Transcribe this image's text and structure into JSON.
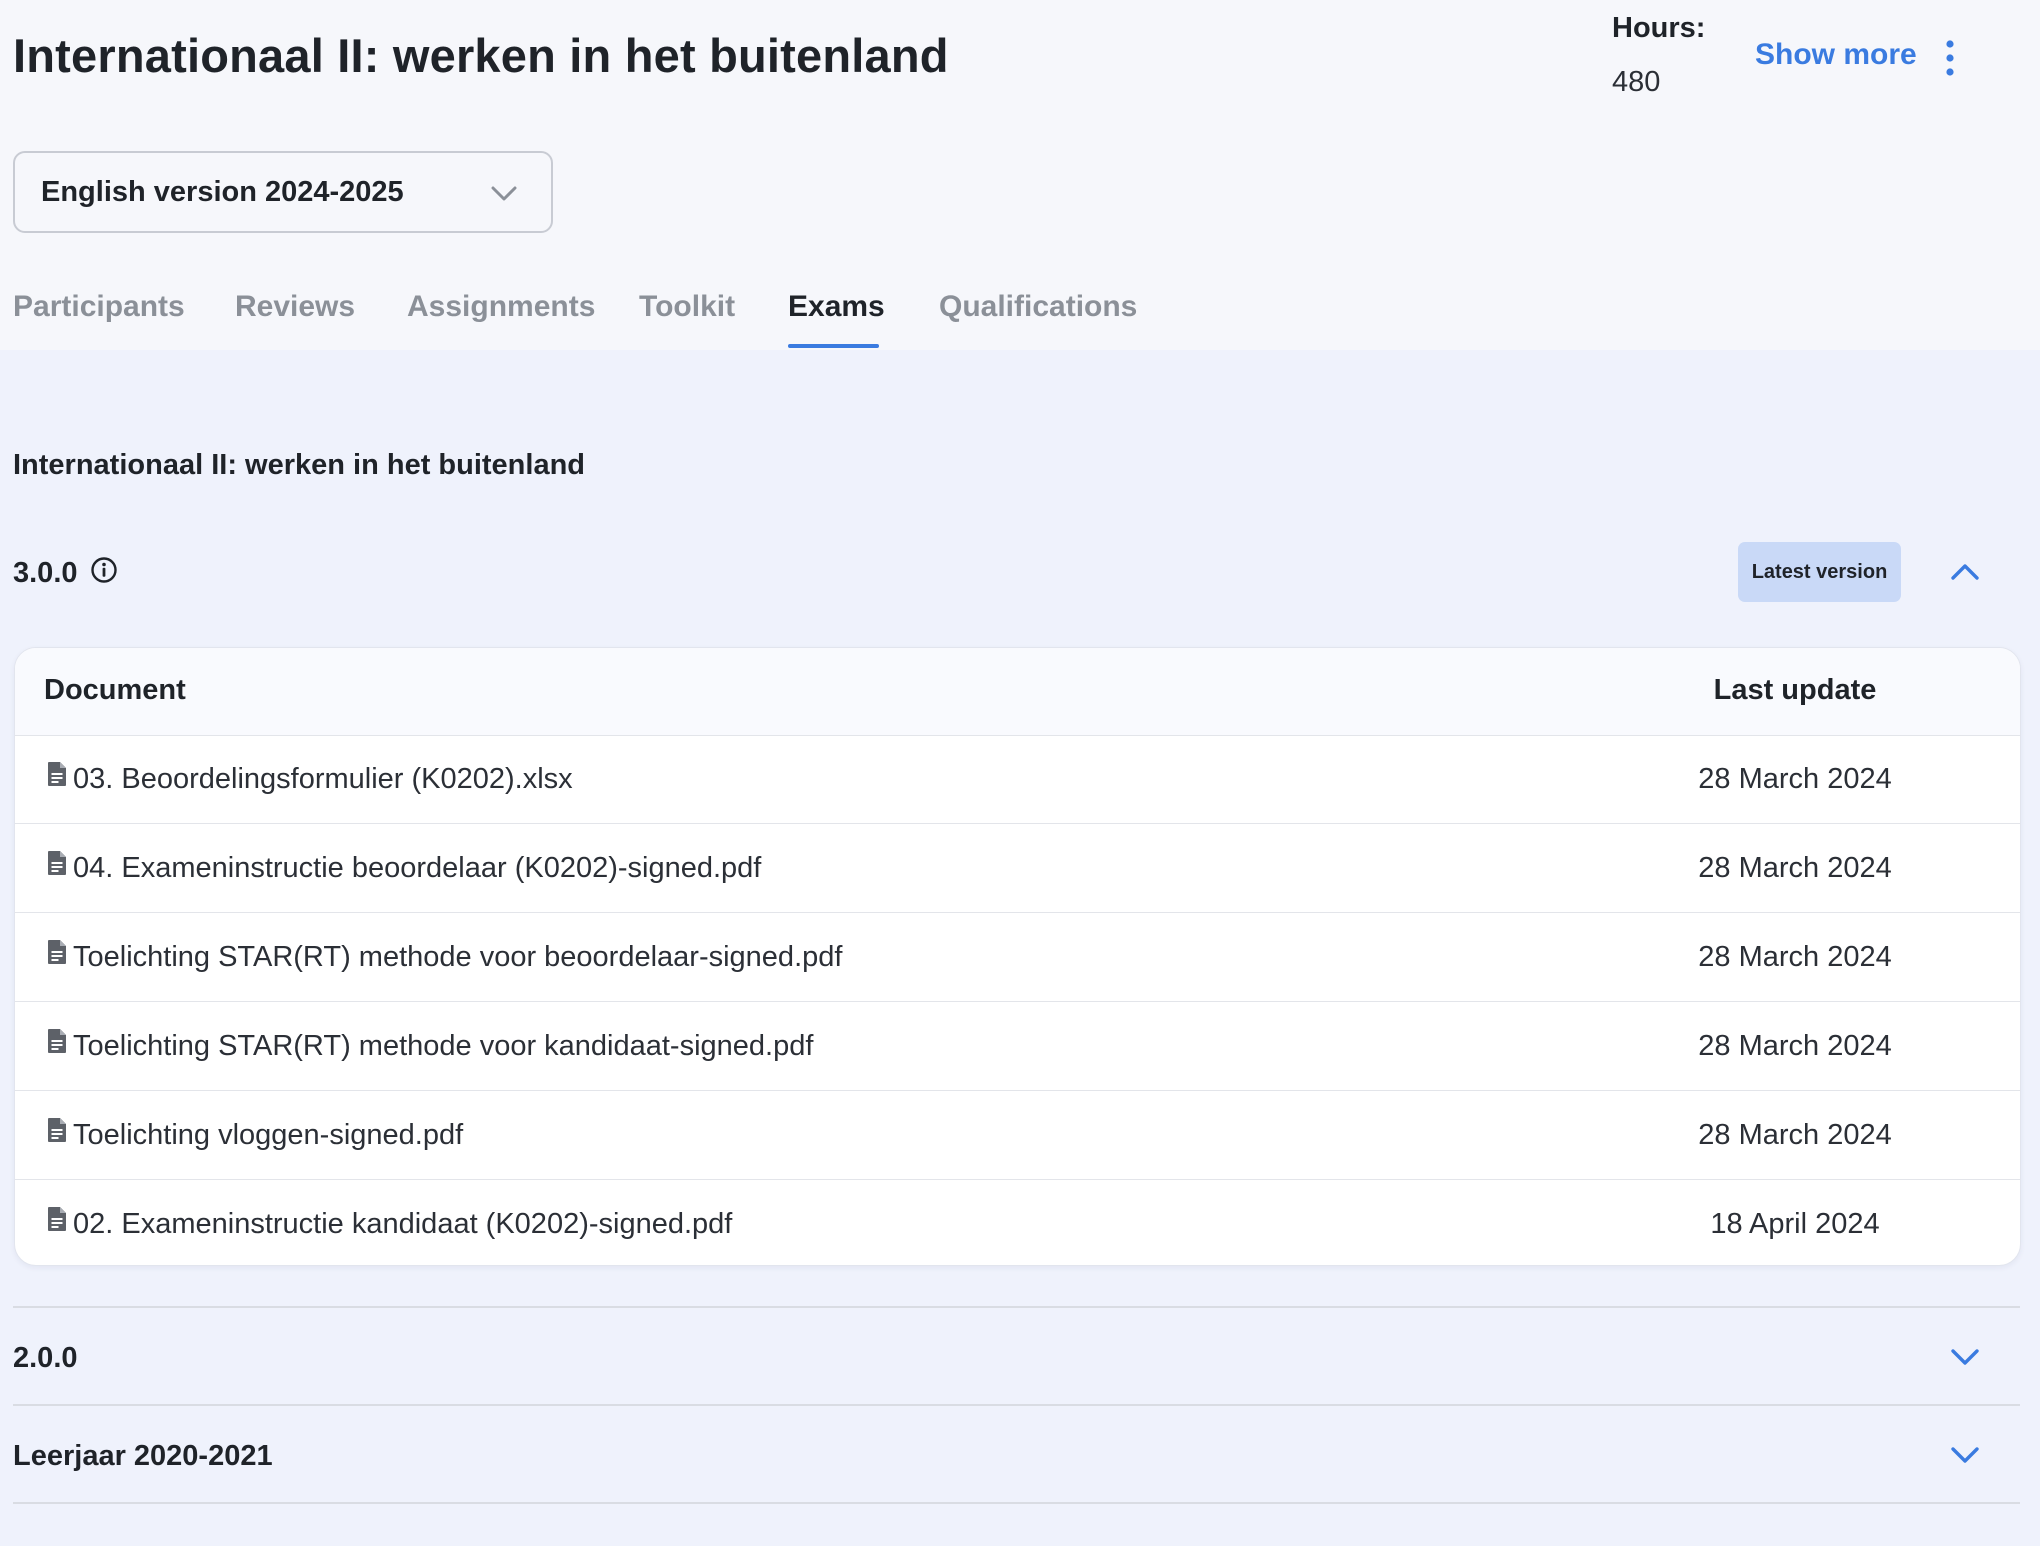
{
  "header": {
    "title": "Internationaal II: werken in het buitenland",
    "hours_label": "Hours:",
    "hours_value": "480",
    "show_more_label": "Show more"
  },
  "version_select": {
    "selected": "English version 2024-2025"
  },
  "tabs": [
    {
      "label": "Participants",
      "active": false
    },
    {
      "label": "Reviews",
      "active": false
    },
    {
      "label": "Assignments",
      "active": false
    },
    {
      "label": "Toolkit",
      "active": false
    },
    {
      "label": "Exams",
      "active": true
    },
    {
      "label": "Qualifications",
      "active": false
    }
  ],
  "main": {
    "section_title": "Internationaal II: werken in het buitenland",
    "versions": [
      {
        "label": "3.0.0",
        "badge": "Latest version",
        "expanded": true,
        "table": {
          "columns": [
            "Document",
            "Last update"
          ],
          "rows": [
            {
              "document": "03. Beoordelingsformulier (K0202).xlsx",
              "last_update": "28 March 2024"
            },
            {
              "document": "04. Exameninstructie beoordelaar (K0202)-signed.pdf",
              "last_update": "28 March 2024"
            },
            {
              "document": "Toelichting STAR(RT) methode voor beoordelaar-signed.pdf",
              "last_update": "28 March 2024"
            },
            {
              "document": "Toelichting STAR(RT) methode voor kandidaat-signed.pdf",
              "last_update": "28 March 2024"
            },
            {
              "document": "Toelichting vloggen-signed.pdf",
              "last_update": "28 March 2024"
            },
            {
              "document": "02. Exameninstructie kandidaat (K0202)-signed.pdf",
              "last_update": "18 April 2024"
            }
          ]
        }
      },
      {
        "label": "2.0.0",
        "expanded": false
      },
      {
        "label": "Leerjaar 2020-2021",
        "expanded": false
      }
    ]
  },
  "colors": {
    "accent": "#3a7be0",
    "badge_bg": "#c9d9f7",
    "page_bg": "#eff2fc",
    "header_bg": "#f6f7fb"
  },
  "icons": {
    "info": "info-circle-icon",
    "file": "document-file-icon",
    "chevron_up": "chevron-up-icon",
    "chevron_down": "chevron-down-icon",
    "more": "vertical-dots-icon"
  }
}
